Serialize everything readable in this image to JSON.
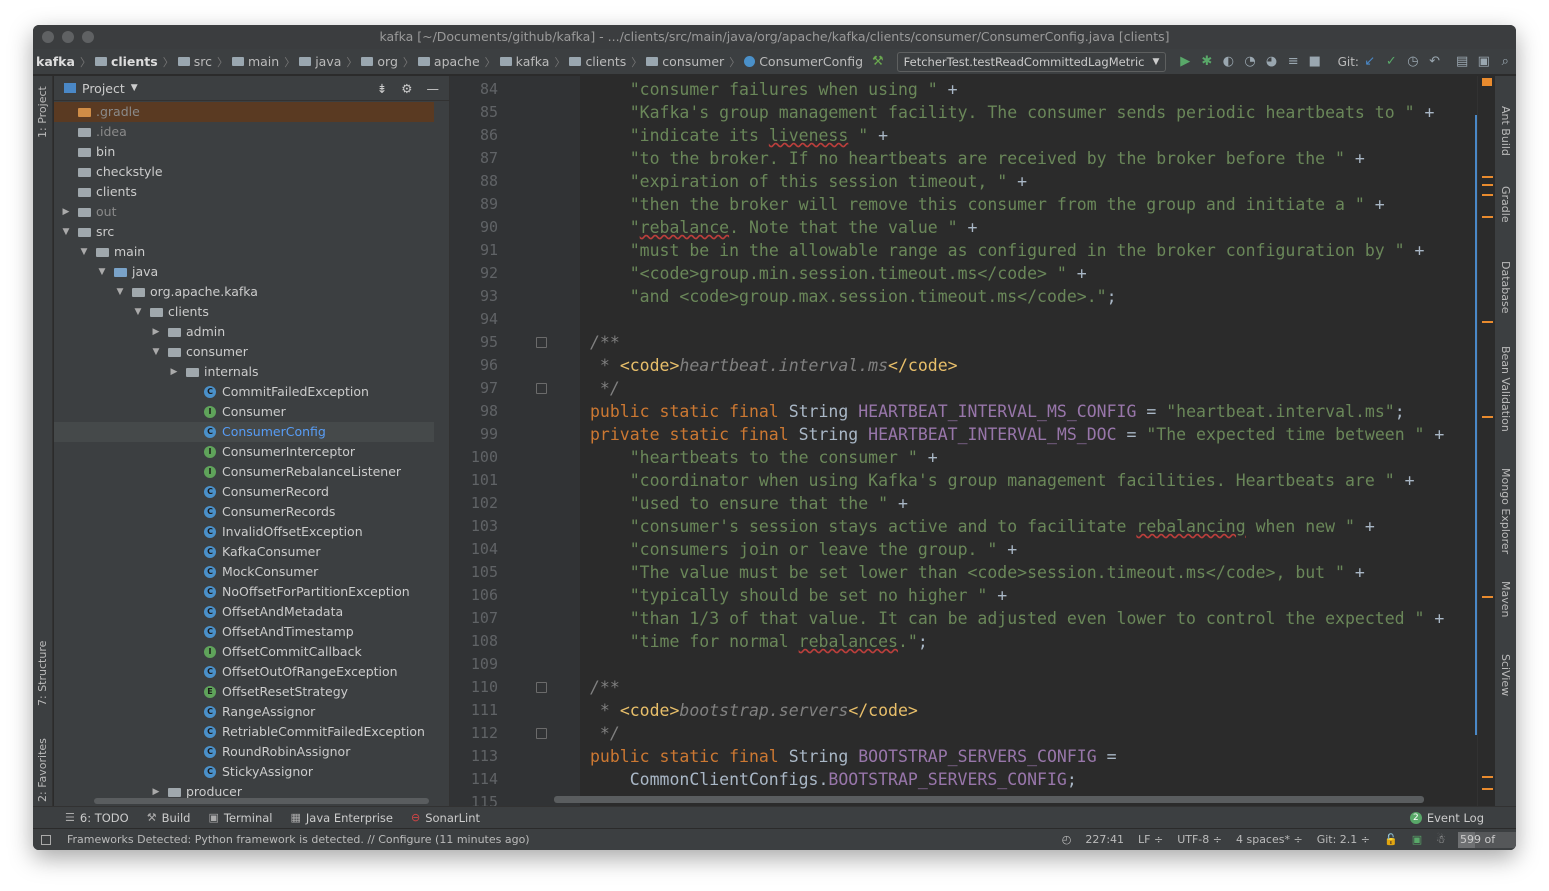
{
  "window": {
    "title": "kafka [~/Documents/github/kafka] - .../clients/src/main/java/org/apache/kafka/clients/consumer/ConsumerConfig.java [clients]"
  },
  "navbar": {
    "breadcrumbs": [
      "kafka",
      "clients",
      "src",
      "main",
      "java",
      "org",
      "apache",
      "kafka",
      "clients",
      "consumer",
      "ConsumerConfig"
    ],
    "run_config": "FetcherTest.testReadCommittedLagMetric",
    "git_label": "Git:"
  },
  "left_stripe": {
    "project_tab": "1: Project",
    "structure_tab": "7: Structure",
    "favorites_tab": "2: Favorites"
  },
  "right_stripe": {
    "tabs": [
      "Ant Build",
      "Gradle",
      "Database",
      "Bean Validation",
      "Mongo Explorer",
      "Maven",
      "SciView"
    ]
  },
  "project": {
    "header": "Project",
    "tree": [
      {
        "label": ".gradle",
        "kind": "folder",
        "depth": 0,
        "style": "dim"
      },
      {
        "label": ".idea",
        "kind": "folder",
        "depth": 0,
        "style": "dim"
      },
      {
        "label": "bin",
        "kind": "folder",
        "depth": 0
      },
      {
        "label": "checkstyle",
        "kind": "folder",
        "depth": 0
      },
      {
        "label": "clients",
        "kind": "folder",
        "depth": 0
      },
      {
        "label": "out",
        "kind": "folder",
        "depth": 0,
        "arrow": "collapsed",
        "style": "dim"
      },
      {
        "label": "src",
        "kind": "folder",
        "depth": 0,
        "arrow": "expanded"
      },
      {
        "label": "main",
        "kind": "folder",
        "depth": 1,
        "arrow": "expanded"
      },
      {
        "label": "java",
        "kind": "src",
        "depth": 2,
        "arrow": "expanded"
      },
      {
        "label": "org.apache.kafka",
        "kind": "pkg",
        "depth": 3,
        "arrow": "expanded"
      },
      {
        "label": "clients",
        "kind": "pkg",
        "depth": 4,
        "arrow": "expanded"
      },
      {
        "label": "admin",
        "kind": "pkg",
        "depth": 5,
        "arrow": "collapsed"
      },
      {
        "label": "consumer",
        "kind": "pkg",
        "depth": 5,
        "arrow": "expanded"
      },
      {
        "label": "internals",
        "kind": "pkg",
        "depth": 6,
        "arrow": "collapsed"
      },
      {
        "label": "CommitFailedException",
        "kind": "class",
        "depth": 7
      },
      {
        "label": "Consumer",
        "kind": "iface",
        "depth": 7
      },
      {
        "label": "ConsumerConfig",
        "kind": "class",
        "depth": 7,
        "current": true
      },
      {
        "label": "ConsumerInterceptor",
        "kind": "iface",
        "depth": 7
      },
      {
        "label": "ConsumerRebalanceListener",
        "kind": "iface",
        "depth": 7
      },
      {
        "label": "ConsumerRecord",
        "kind": "class",
        "depth": 7
      },
      {
        "label": "ConsumerRecords",
        "kind": "class",
        "depth": 7
      },
      {
        "label": "InvalidOffsetException",
        "kind": "class",
        "depth": 7
      },
      {
        "label": "KafkaConsumer",
        "kind": "class",
        "depth": 7
      },
      {
        "label": "MockConsumer",
        "kind": "class",
        "depth": 7
      },
      {
        "label": "NoOffsetForPartitionException",
        "kind": "class",
        "depth": 7
      },
      {
        "label": "OffsetAndMetadata",
        "kind": "class",
        "depth": 7
      },
      {
        "label": "OffsetAndTimestamp",
        "kind": "class",
        "depth": 7
      },
      {
        "label": "OffsetCommitCallback",
        "kind": "iface",
        "depth": 7
      },
      {
        "label": "OffsetOutOfRangeException",
        "kind": "class",
        "depth": 7
      },
      {
        "label": "OffsetResetStrategy",
        "kind": "enum",
        "depth": 7
      },
      {
        "label": "RangeAssignor",
        "kind": "class",
        "depth": 7
      },
      {
        "label": "RetriableCommitFailedException",
        "kind": "class",
        "depth": 7
      },
      {
        "label": "RoundRobinAssignor",
        "kind": "class",
        "depth": 7
      },
      {
        "label": "StickyAssignor",
        "kind": "class",
        "depth": 7
      },
      {
        "label": "producer",
        "kind": "pkg",
        "depth": 5,
        "arrow": "collapsed"
      }
    ]
  },
  "editor": {
    "lines": [
      {
        "n": "84",
        "html": "    <span class='str'>\"consumer failures when using \"</span> +"
      },
      {
        "n": "85",
        "html": "    <span class='str'>\"Kafka's group management facility. The consumer sends periodic heartbeats to \"</span> +"
      },
      {
        "n": "86",
        "html": "    <span class='str'>\"indicate its <span class='wv'>liveness</span> \"</span> +"
      },
      {
        "n": "87",
        "html": "    <span class='str'>\"to the broker. If no heartbeats are received by the broker before the \"</span> +"
      },
      {
        "n": "88",
        "html": "    <span class='str'>\"expiration of this session timeout, \"</span> +"
      },
      {
        "n": "89",
        "html": "    <span class='str'>\"then the broker will remove this consumer from the group and initiate a \"</span> +"
      },
      {
        "n": "90",
        "html": "    <span class='str'>\"<span class='wv'>rebalance</span>. Note that the value \"</span> +"
      },
      {
        "n": "91",
        "html": "    <span class='str'>\"must be in the allowable range as configured in the broker configuration by \"</span> +"
      },
      {
        "n": "92",
        "html": "    <span class='str'>\"&lt;code&gt;group.min.session.timeout.ms&lt;/code&gt; \"</span> +"
      },
      {
        "n": "93",
        "html": "    <span class='str'>\"and &lt;code&gt;group.max.session.timeout.ms&lt;/code&gt;.\"</span>;"
      },
      {
        "n": "94",
        "html": ""
      },
      {
        "n": "95",
        "html": "<span class='cm-i'>/**</span>",
        "fold": true
      },
      {
        "n": "96",
        "html": "<span class='cm-i'> * </span><span class='tag'>&lt;code&gt;</span><span class='cm-i'>heartbeat.interval.ms</span><span class='tag'>&lt;/code&gt;</span>"
      },
      {
        "n": "97",
        "html": "<span class='cm-i'> */</span>",
        "fold": true
      },
      {
        "n": "98",
        "html": "<span class='kw'>public static final </span>String <span class='con'>HEARTBEAT_INTERVAL_MS_CONFIG</span> = <span class='str'>\"heartbeat.interval.ms\"</span>;"
      },
      {
        "n": "99",
        "html": "<span class='kw'>private static final </span>String <span class='con'>HEARTBEAT_INTERVAL_MS_DOC</span> = <span class='str'>\"The expected time between \"</span> +"
      },
      {
        "n": "100",
        "html": "    <span class='str'>\"heartbeats to the consumer \"</span> +"
      },
      {
        "n": "101",
        "html": "    <span class='str'>\"coordinator when using Kafka's group management facilities. Heartbeats are \"</span> +"
      },
      {
        "n": "102",
        "html": "    <span class='str'>\"used to ensure that the \"</span> +"
      },
      {
        "n": "103",
        "html": "    <span class='str'>\"consumer's session stays active and to facilitate <span class='wv'>rebalancing</span> when new \"</span> +"
      },
      {
        "n": "104",
        "html": "    <span class='str'>\"consumers join or leave the group. \"</span> +"
      },
      {
        "n": "105",
        "html": "    <span class='str'>\"The value must be set lower than &lt;code&gt;session.timeout.ms&lt;/code&gt;, but \"</span> +"
      },
      {
        "n": "106",
        "html": "    <span class='str'>\"typically should be set no higher \"</span> +"
      },
      {
        "n": "107",
        "html": "    <span class='str'>\"than 1/3 of that value. It can be adjusted even lower to control the expected \"</span> +"
      },
      {
        "n": "108",
        "html": "    <span class='str'>\"time for normal <span class='wv'>rebalances</span>.\"</span>;"
      },
      {
        "n": "109",
        "html": ""
      },
      {
        "n": "110",
        "html": "<span class='cm-i'>/**</span>",
        "fold": true
      },
      {
        "n": "111",
        "html": "<span class='cm-i'> * </span><span class='tag'>&lt;code&gt;</span><span class='cm-i'>bootstrap.servers</span><span class='tag'>&lt;/code&gt;</span>"
      },
      {
        "n": "112",
        "html": "<span class='cm-i'> */</span>",
        "fold": true
      },
      {
        "n": "113",
        "html": "<span class='kw'>public static final </span>String <span class='con'>BOOTSTRAP_SERVERS_CONFIG</span> ="
      },
      {
        "n": "114",
        "html": "    CommonClientConfigs.<span class='con'>BOOTSTRAP_SERVERS_CONFIG</span>;"
      },
      {
        "n": "115",
        "html": ""
      }
    ]
  },
  "bottom_tools": {
    "todo": "6: TODO",
    "build": "Build",
    "terminal": "Terminal",
    "java_enterprise": "Java Enterprise",
    "sonarlint": "SonarLint",
    "event_log": "Event Log",
    "event_count": "2"
  },
  "status": {
    "message": "Frameworks Detected: Python framework is detected. // Configure (11 minutes ago)",
    "position": "227:41",
    "line_sep": "LF ÷",
    "encoding": "UTF-8 ÷",
    "indent": "4 spaces* ÷",
    "git": "Git: 2.1 ÷",
    "memory": "599 of 1981M",
    "memory_fraction": 0.3
  },
  "colors": {
    "keyword": "#cc7832",
    "string": "#6a8759",
    "constant": "#9876aa",
    "comment": "#808080",
    "tag": "#e8bf6a",
    "selection_dir": "#5a3a22",
    "link_blue": "#589df6"
  }
}
